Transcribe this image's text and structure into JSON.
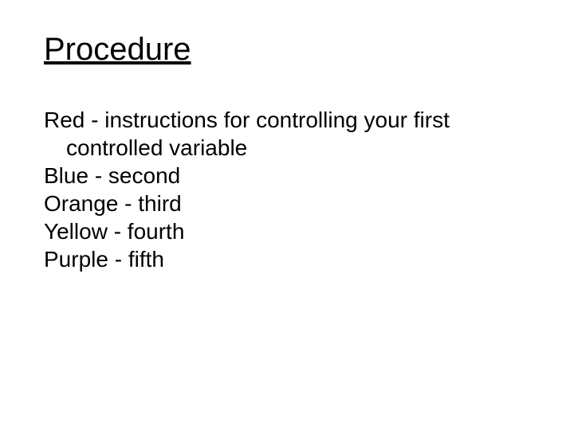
{
  "heading": "Procedure",
  "lines": {
    "l0": "Red - instructions for controlling your first",
    "l0b": "controlled variable",
    "l1": "Blue - second",
    "l2": "Orange - third",
    "l3": "Yellow - fourth",
    "l4": "Purple - fifth"
  }
}
